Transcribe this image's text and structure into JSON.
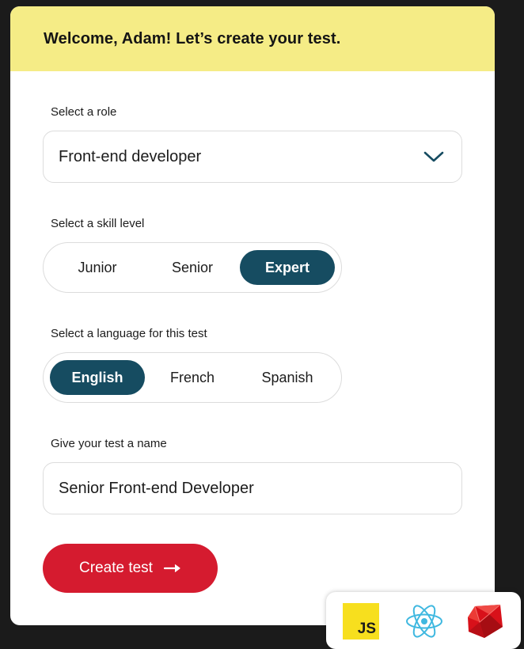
{
  "header": {
    "title": "Welcome, Adam! Let’s create your test."
  },
  "role": {
    "label": "Select a role",
    "selected": "Front-end developer",
    "chevron_icon": "chevron-down-icon"
  },
  "skill": {
    "label": "Select a skill level",
    "options": [
      "Junior",
      "Senior",
      "Expert"
    ],
    "selected": "Expert"
  },
  "language": {
    "label": "Select a language for this test",
    "options": [
      "English",
      "French",
      "Spanish"
    ],
    "selected": "English"
  },
  "test_name": {
    "label": "Give your test a name",
    "value": "Senior Front-end Developer"
  },
  "cta": {
    "label": "Create test",
    "icon": "arrow-right-icon"
  },
  "tech": {
    "js_label": "JS",
    "icons": [
      "javascript-logo",
      "react-logo",
      "ruby-logo"
    ]
  },
  "colors": {
    "header_bg": "#f5ec86",
    "accent": "#164c61",
    "cta": "#d51b2f",
    "page_bg": "#1b1b1b"
  }
}
